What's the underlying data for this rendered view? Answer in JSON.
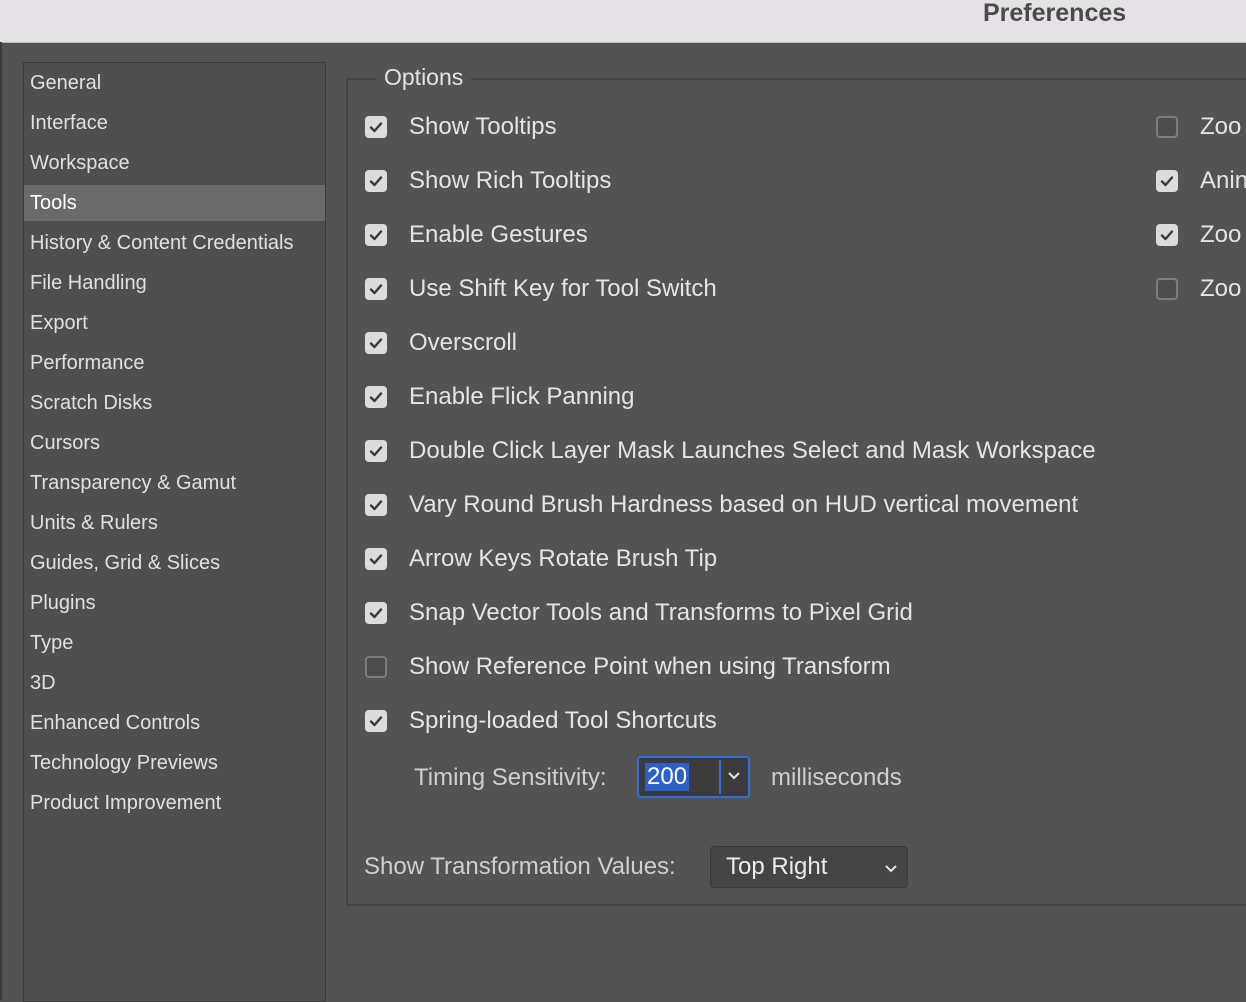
{
  "window": {
    "title": "Preferences"
  },
  "sidebar": {
    "items": [
      {
        "label": "General"
      },
      {
        "label": "Interface"
      },
      {
        "label": "Workspace"
      },
      {
        "label": "Tools",
        "selected": true
      },
      {
        "label": "History & Content Credentials"
      },
      {
        "label": "File Handling"
      },
      {
        "label": "Export"
      },
      {
        "label": "Performance"
      },
      {
        "label": "Scratch Disks"
      },
      {
        "label": "Cursors"
      },
      {
        "label": "Transparency & Gamut"
      },
      {
        "label": "Units & Rulers"
      },
      {
        "label": "Guides, Grid & Slices"
      },
      {
        "label": "Plugins"
      },
      {
        "label": "Type"
      },
      {
        "label": "3D"
      },
      {
        "label": "Enhanced Controls"
      },
      {
        "label": "Technology Previews"
      },
      {
        "label": "Product Improvement"
      }
    ]
  },
  "options": {
    "legend": "Options",
    "left": [
      {
        "label": "Show Tooltips",
        "checked": true
      },
      {
        "label": "Show Rich Tooltips",
        "checked": true
      },
      {
        "label": "Enable Gestures",
        "checked": true
      },
      {
        "label": "Use Shift Key for Tool Switch",
        "checked": true
      },
      {
        "label": "Overscroll",
        "checked": true
      },
      {
        "label": "Enable Flick Panning",
        "checked": true
      },
      {
        "label": "Double Click Layer Mask Launches Select and Mask Workspace",
        "checked": true
      },
      {
        "label": "Vary Round Brush Hardness based on HUD vertical movement",
        "checked": true
      },
      {
        "label": "Arrow Keys Rotate Brush Tip",
        "checked": true
      },
      {
        "label": "Snap Vector Tools and Transforms to Pixel Grid",
        "checked": true
      },
      {
        "label": "Show Reference Point when using Transform",
        "checked": false
      },
      {
        "label": "Spring-loaded Tool Shortcuts",
        "checked": true
      }
    ],
    "right": [
      {
        "label": "Zoo",
        "checked": false
      },
      {
        "label": "Anin",
        "checked": true
      },
      {
        "label": "Zoo",
        "checked": true
      },
      {
        "label": "Zoo",
        "checked": false
      }
    ],
    "timing": {
      "label": "Timing Sensitivity:",
      "value": "200",
      "unit": "milliseconds"
    },
    "transform": {
      "label": "Show Transformation Values:",
      "value": "Top Right"
    }
  },
  "icons": {
    "checkbox_checked": "checkmark-icon",
    "dropdown": "chevron-down-icon"
  },
  "colors": {
    "background": "#535353",
    "sidebar_background": "#4f4f4f",
    "sidebar_selected": "#6a6a6a",
    "titlebar": "#e5e1e6",
    "focus_ring": "#2f6fdc",
    "text_selection": "#2b61c9"
  }
}
